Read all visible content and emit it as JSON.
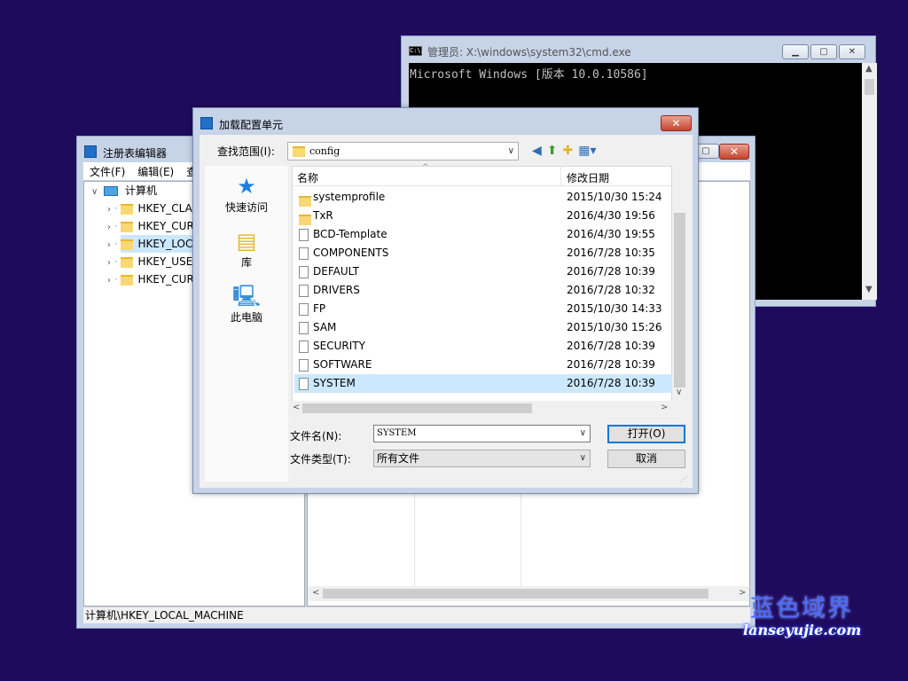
{
  "cmd": {
    "title": "管理员: X:\\windows\\system32\\cmd.exe",
    "icon_text": "C:\\.",
    "output": "Microsoft Windows [版本 10.0.10586]"
  },
  "regedit": {
    "title": "注册表编辑器",
    "menu": [
      "文件(F)",
      "编辑(E)",
      "查"
    ],
    "tree_root": "计算机",
    "tree_items": [
      "HKEY_CLAS",
      "HKEY_CUR",
      "HKEY_LOC",
      "HKEY_USE",
      "HKEY_CUR"
    ],
    "status": "计算机\\HKEY_LOCAL_MACHINE"
  },
  "dialog": {
    "title": "加载配置单元",
    "look_in_label": "查找范围(I):",
    "look_in_value": "config",
    "places": [
      "快速访问",
      "库",
      "此电脑"
    ],
    "columns": {
      "name": "名称",
      "date": "修改日期"
    },
    "files": [
      {
        "name": "systemprofile",
        "date": "2015/10/30 15:24",
        "type": "folder"
      },
      {
        "name": "TxR",
        "date": "2016/4/30 19:56",
        "type": "folder"
      },
      {
        "name": "BCD-Template",
        "date": "2016/4/30 19:55",
        "type": "file"
      },
      {
        "name": "COMPONENTS",
        "date": "2016/7/28 10:35",
        "type": "file"
      },
      {
        "name": "DEFAULT",
        "date": "2016/7/28 10:39",
        "type": "file"
      },
      {
        "name": "DRIVERS",
        "date": "2016/7/28 10:32",
        "type": "file"
      },
      {
        "name": "FP",
        "date": "2015/10/30 14:33",
        "type": "file"
      },
      {
        "name": "SAM",
        "date": "2015/10/30 15:26",
        "type": "file"
      },
      {
        "name": "SECURITY",
        "date": "2016/7/28 10:39",
        "type": "file"
      },
      {
        "name": "SOFTWARE",
        "date": "2016/7/28 10:39",
        "type": "file"
      },
      {
        "name": "SYSTEM",
        "date": "2016/7/28 10:39",
        "type": "file",
        "selected": true
      }
    ],
    "filename_label": "文件名(N):",
    "filename_value": "SYSTEM",
    "filetype_label": "文件类型(T):",
    "filetype_value": "所有文件",
    "open_button": "打开(O)",
    "cancel_button": "取消"
  },
  "watermark": {
    "cn": "蓝色域界",
    "url": "lanseyujie.com"
  },
  "colors": {
    "desktop": "#1f0b5e",
    "selection": "#cce8ff",
    "accent": "#0078d7"
  }
}
